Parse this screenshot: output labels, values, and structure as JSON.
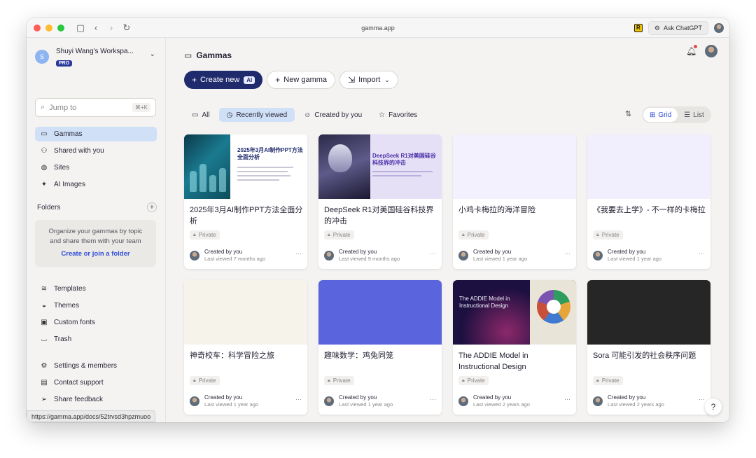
{
  "browser": {
    "url": "gamma.app",
    "ask_chatgpt": "Ask ChatGPT",
    "status_url": "https://gamma.app/docs/52trvsd3hpzmuoo"
  },
  "sidebar": {
    "workspace_initial": "S",
    "workspace_name": "Shuyi Wang's Workspa...",
    "workspace_badge": "PRO",
    "jump_placeholder": "Jump to",
    "jump_shortcut": "⌘+K",
    "primary_nav": [
      {
        "label": "Gammas",
        "icon": "deck-icon"
      },
      {
        "label": "Shared with you",
        "icon": "people-icon"
      },
      {
        "label": "Sites",
        "icon": "globe-icon"
      },
      {
        "label": "AI Images",
        "icon": "sparkle-icon"
      }
    ],
    "folders_label": "Folders",
    "folders_desc_1": "Organize your gammas by topic",
    "folders_desc_2": "and share them with your team",
    "folders_link": "Create or join a folder",
    "secondary_nav": [
      {
        "label": "Templates",
        "icon": "layers-icon"
      },
      {
        "label": "Themes",
        "icon": "palette-icon"
      },
      {
        "label": "Custom fonts",
        "icon": "font-icon"
      },
      {
        "label": "Trash",
        "icon": "trash-icon"
      }
    ],
    "tertiary_nav": [
      {
        "label": "Settings & members",
        "icon": "settings-icon"
      },
      {
        "label": "Contact support",
        "icon": "chat-icon"
      },
      {
        "label": "Share feedback",
        "icon": "send-icon"
      }
    ]
  },
  "main": {
    "title": "Gammas",
    "buttons": {
      "create_new": "Create new",
      "ai_badge": "AI",
      "new_gamma": "New gamma",
      "import": "Import"
    },
    "filters": [
      "All",
      "Recently viewed",
      "Created by you",
      "Favorites"
    ],
    "active_filter": "Recently viewed",
    "view": {
      "grid": "Grid",
      "list": "List",
      "active": "Grid"
    },
    "cards": [
      {
        "title": "2025年3月AI制作PPT方法全面分析",
        "thumb_title": "2025年3月AI制作PPT方法全面分析",
        "privacy": "Private",
        "created_by": "Created by you",
        "last_viewed": "Last viewed 7 months ago"
      },
      {
        "title": "DeepSeek R1对美国硅谷科技界的冲击",
        "thumb_title": "DeepSeek R1对美国硅谷科技界的冲击",
        "privacy": "Private",
        "created_by": "Created by you",
        "last_viewed": "Last viewed 9 months ago"
      },
      {
        "title": "小鸡卡梅拉的海洋冒险",
        "privacy": "Private",
        "created_by": "Created by you",
        "last_viewed": "Last viewed 1 year ago"
      },
      {
        "title": "《我要去上学》- 不一样的卡梅拉",
        "privacy": "Private",
        "created_by": "Created by you",
        "last_viewed": "Last viewed 1 year ago"
      },
      {
        "title": "神奇校车：科学冒险之旅",
        "privacy": "Private",
        "created_by": "Created by you",
        "last_viewed": "Last viewed 1 year ago"
      },
      {
        "title": "趣味数学：鸡兔同笼",
        "privacy": "Private",
        "created_by": "Created by you",
        "last_viewed": "Last viewed 1 year ago"
      },
      {
        "title": "The ADDIE Model in Instructional Design",
        "thumb_title": "The ADDIE Model in Instructional Design",
        "privacy": "Private",
        "created_by": "Created by you",
        "last_viewed": "Last viewed 2 years ago"
      },
      {
        "title": "Sora 可能引发的社会秩序问题",
        "privacy": "Private",
        "created_by": "Created by you",
        "last_viewed": "Last viewed 2 years ago"
      }
    ],
    "help": "?"
  }
}
